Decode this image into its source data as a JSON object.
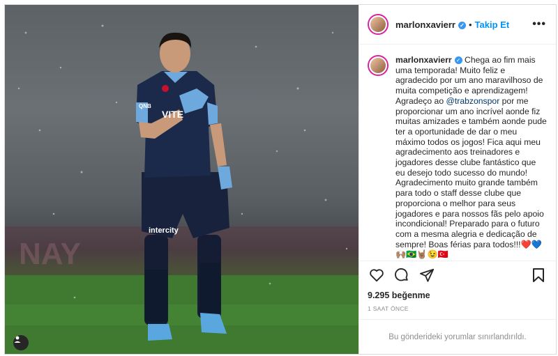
{
  "post": {
    "username": "marlonxavierr",
    "verified_icon": "verified-badge-icon",
    "follow_separator": "•",
    "follow_label": "Takip Et",
    "more_label": "•••",
    "caption_username": "marlonxavierr",
    "caption_part1": "Chega ao fim mais uma temporada! Muito feliz e agradecido por um ano maravilhoso de muita competição e aprendizagem! Agradeço ao ",
    "caption_mention": "@trabzonspor",
    "caption_part2": " por me proporcionar um ano incrível aonde fiz muitas amizades e também aonde pude ter a oportunidade de dar o meu máximo todos os jogos! Fica aqui meu agradecimento aos treinadores e jogadores desse clube fantástico que eu desejo todo sucesso do mundo! Agradecimento muito grande também para todo o staff desse clube que proporciona o melhor para seus jogadores e para nossos fãs pelo apoio incondicional! Preparado para o futuro com a mesma alegria e dedicação de sempre! Boas férias para todos!!!❤️💙🙌🏽🇧🇷🤘🏽😉🇹🇷",
    "likes": "9.295 beğenme",
    "time": "1 SAAT ÖNCE",
    "comments_restricted": "Bu gönderideki yorumlar sınırlandırıldı."
  },
  "photo": {
    "jersey_text": "VITE",
    "sponsor_text": "intercity",
    "badge_text": "QNB"
  },
  "icons": {
    "like": "heart-icon",
    "comment": "comment-icon",
    "share": "paper-plane-icon",
    "save": "bookmark-icon",
    "user_tag": "user-tag-icon"
  },
  "colors": {
    "accent": "#0095f6",
    "verified": "#3897f0",
    "kit_navy": "#1b2a4a",
    "kit_lightblue": "#6fa8dc",
    "pitch": "#3f7a30"
  }
}
